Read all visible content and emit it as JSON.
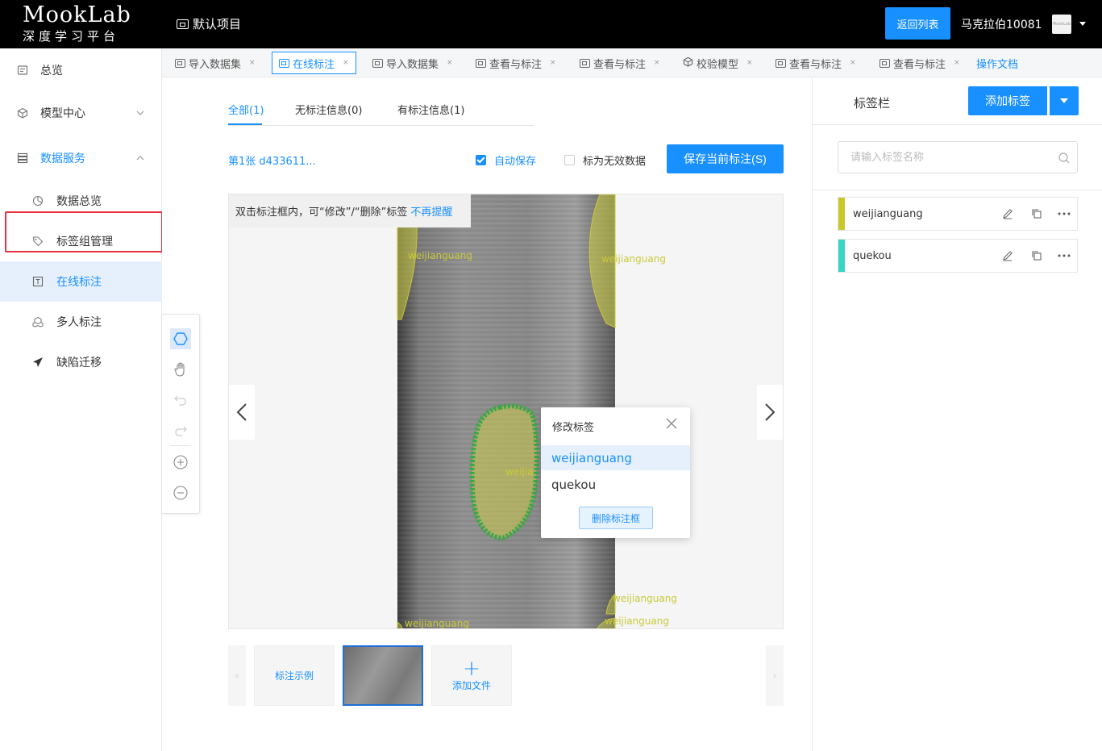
{
  "header": {
    "logo_main": "MookLab",
    "logo_sub": "深度学习平台",
    "project": "默认项目",
    "back_button": "返回列表",
    "username": "马克拉伯10081",
    "avatar_text": "MookLab"
  },
  "sidebar": {
    "items": [
      {
        "label": "总览",
        "icon": "overview-icon"
      },
      {
        "label": "模型中心",
        "icon": "cube-icon",
        "chevron": "down"
      },
      {
        "label": "数据服务",
        "icon": "database-icon",
        "chevron": "up"
      },
      {
        "label": "数据总览",
        "icon": "pie-icon"
      },
      {
        "label": "标签组管理",
        "icon": "tag-icon"
      },
      {
        "label": "在线标注",
        "icon": "text-box-icon",
        "active": true
      },
      {
        "label": "多人标注",
        "icon": "cubes-icon"
      },
      {
        "label": "缺陷迁移",
        "icon": "send-icon"
      }
    ]
  },
  "tabs": [
    {
      "label": "导入数据集"
    },
    {
      "label": "在线标注",
      "current": true
    },
    {
      "label": "导入数据集"
    },
    {
      "label": "查看与标注"
    },
    {
      "label": "查看与标注"
    },
    {
      "label": "校验模型"
    },
    {
      "label": "查看与标注"
    },
    {
      "label": "查看与标注"
    },
    {
      "label": "操作文档",
      "link": true
    }
  ],
  "filter_tabs": [
    {
      "label": "全部(1)",
      "active": true
    },
    {
      "label": "无标注信息(0)"
    },
    {
      "label": "有标注信息(1)"
    }
  ],
  "toolbar": {
    "file_label": "第1张 d433611...",
    "auto_save_label": "自动保存",
    "auto_save_checked": true,
    "invalid_label": "标为无效数据",
    "invalid_checked": false,
    "save_button": "保存当前标注(S)"
  },
  "canvas": {
    "hint_text": "双击标注框内，可“修改”/“删除”标签",
    "hint_link": "不再提醒",
    "annotations": [
      "weijianguang",
      "weijianguang",
      "weijia",
      "weijianguang",
      "weijianguang",
      "weijianguang"
    ]
  },
  "popup": {
    "title": "修改标签",
    "options": [
      "weijianguang",
      "quekou"
    ],
    "selected": "weijianguang",
    "delete_button": "删除标注框"
  },
  "thumbnails": {
    "example_label": "标注示例",
    "add_label": "添加文件"
  },
  "right_panel": {
    "title": "标签栏",
    "add_button": "添加标签",
    "search_placeholder": "请输入标签名称",
    "labels": [
      {
        "name": "weijianguang",
        "color": "#c8c82a"
      },
      {
        "name": "quekou",
        "color": "#36d6c4"
      }
    ]
  },
  "colors": {
    "primary": "#1890ff",
    "highlight_border": "#e8323f",
    "annotation_yellow": "#c9c93a",
    "annotation_green": "#3aa845"
  }
}
